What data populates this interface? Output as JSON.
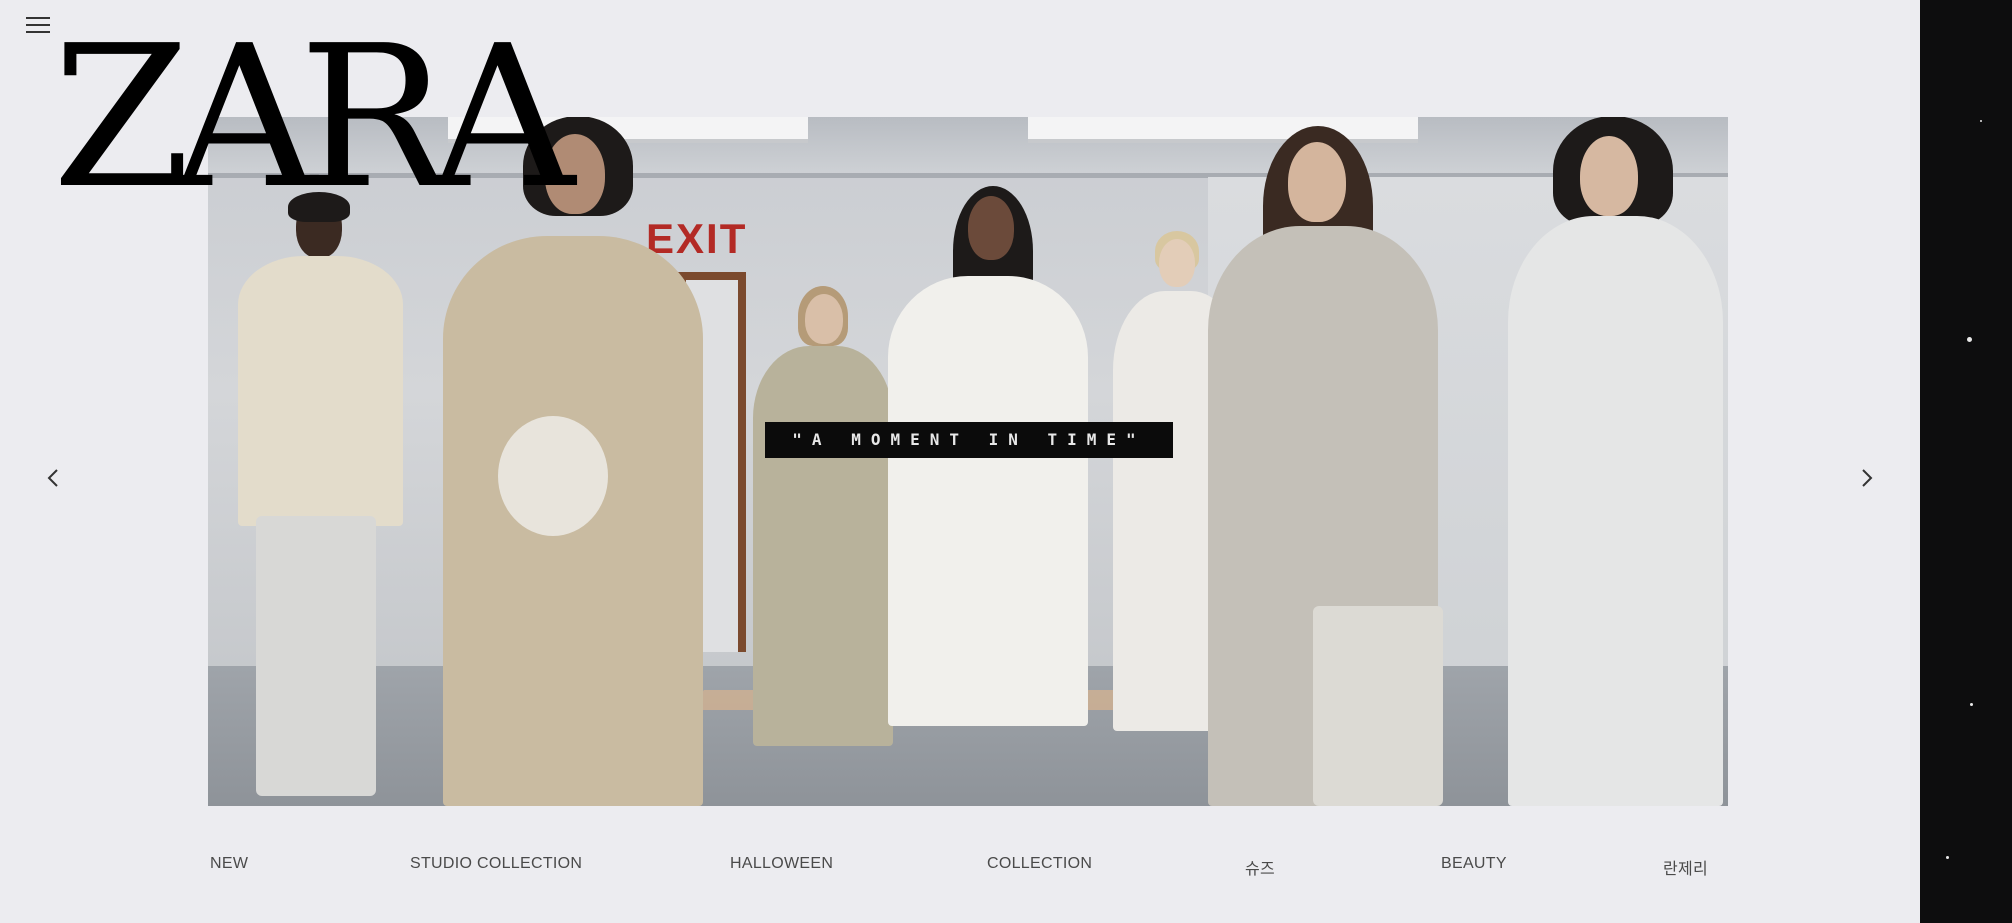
{
  "brand": {
    "logo_text": "ZARA"
  },
  "header": {
    "menu_icon": "hamburger-menu-icon"
  },
  "hero": {
    "caption": "\"A MOMENT IN TIME\"",
    "exit_sign": "EXIT",
    "prev_icon": "chevron-left-icon",
    "next_icon": "chevron-right-icon"
  },
  "nav": {
    "items": [
      {
        "label": "NEW"
      },
      {
        "label": "STUDIO COLLECTION"
      },
      {
        "label": "HALLOWEEN"
      },
      {
        "label": "COLLECTION"
      },
      {
        "label": "슈즈"
      },
      {
        "label": "BEAUTY"
      },
      {
        "label": "란제리"
      }
    ]
  },
  "colors": {
    "page_background": "#ececf0",
    "right_panel": "#0d0d0e",
    "text": "#4a4a4a",
    "logo": "#000000"
  }
}
